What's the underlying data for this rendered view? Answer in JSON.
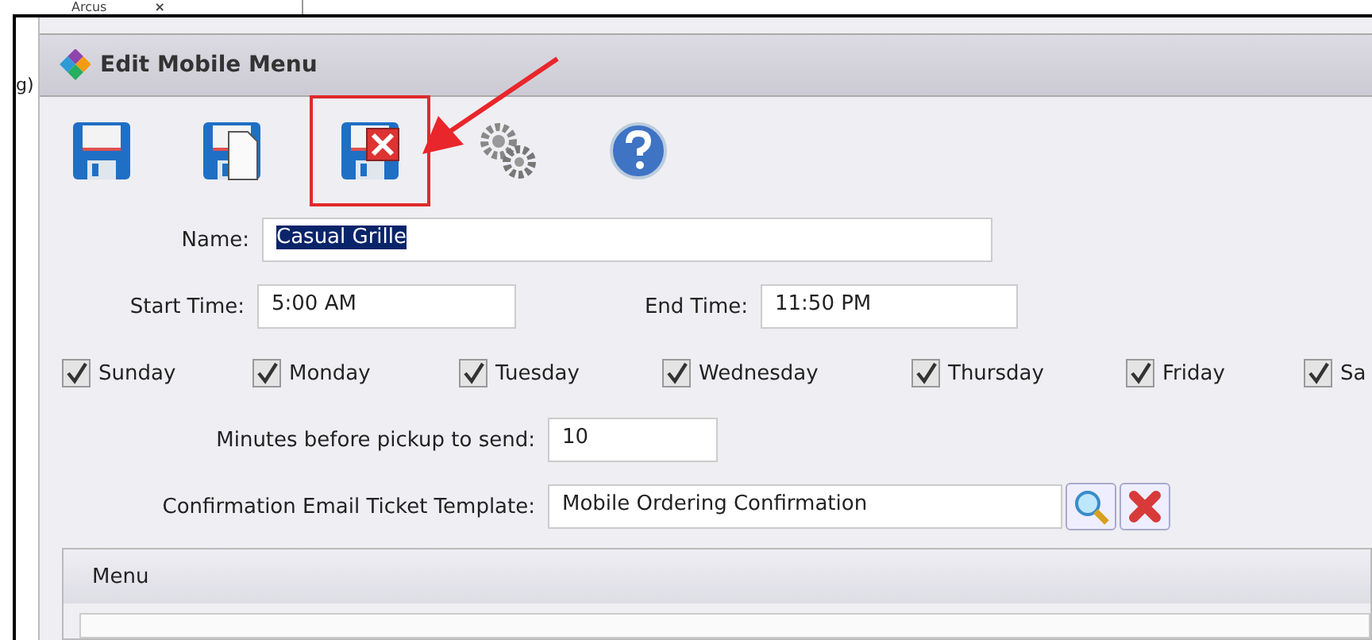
{
  "background_tab": {
    "label": "Arcus",
    "close": "×"
  },
  "background_text": "g)",
  "window": {
    "title": "Edit Mobile Menu"
  },
  "toolbar": [
    {
      "kind": "save",
      "highlighted": false
    },
    {
      "kind": "save-copy",
      "highlighted": false
    },
    {
      "kind": "save-close",
      "highlighted": true
    },
    {
      "kind": "settings",
      "highlighted": false
    },
    {
      "kind": "help",
      "highlighted": false
    }
  ],
  "form": {
    "name": {
      "label": "Name:",
      "value": "Casual Grille",
      "text_selected": true
    },
    "start_time": {
      "label": "Start Time:",
      "value": "5:00 AM"
    },
    "end_time": {
      "label": "End Time:",
      "value": "11:50 PM"
    },
    "days": [
      {
        "label": "Sunday",
        "checked": true
      },
      {
        "label": "Monday",
        "checked": true
      },
      {
        "label": "Tuesday",
        "checked": true
      },
      {
        "label": "Wednesday",
        "checked": true
      },
      {
        "label": "Thursday",
        "checked": true
      },
      {
        "label": "Friday",
        "checked": true
      },
      {
        "label": "Sa",
        "checked": true
      }
    ],
    "minutes": {
      "label": "Minutes before pickup to send:",
      "value": "10"
    },
    "template": {
      "label": "Confirmation Email Ticket Template:",
      "value": "Mobile Ordering Confirmation"
    }
  },
  "menu_group": {
    "title": "Menu"
  }
}
